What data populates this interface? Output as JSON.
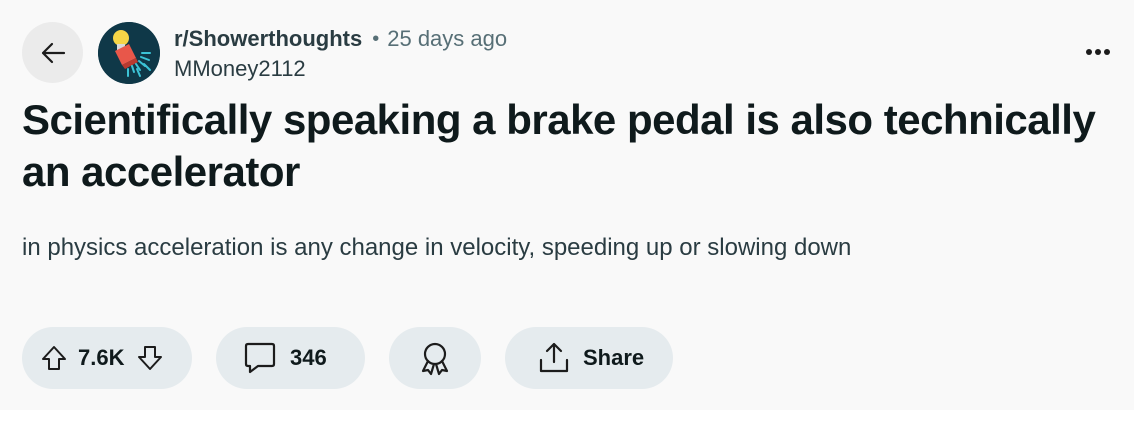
{
  "post": {
    "subreddit": "r/Showerthoughts",
    "separator": "•",
    "time_ago": "25 days ago",
    "author": "MMoney2112",
    "title": "Scientifically speaking a brake pedal is also technically an accelerator",
    "body": "in physics acceleration is any change in velocity, speeding up or slowing down"
  },
  "actions": {
    "score": "7.6K",
    "comments": "346",
    "share_label": "Share"
  },
  "icons": {
    "back": "arrow-left-icon",
    "more": "more-dots-icon",
    "upvote": "arrow-up-outline-icon",
    "downvote": "arrow-down-outline-icon",
    "comment": "speech-bubble-icon",
    "award": "award-ribbon-icon",
    "share": "share-arrow-icon"
  },
  "colors": {
    "page_background": "#f9f9f9",
    "pill_background": "#e5ebee",
    "avatar_background": "#0f3848",
    "title_text": "#0f1a1c",
    "meta_text": "#576f76"
  }
}
